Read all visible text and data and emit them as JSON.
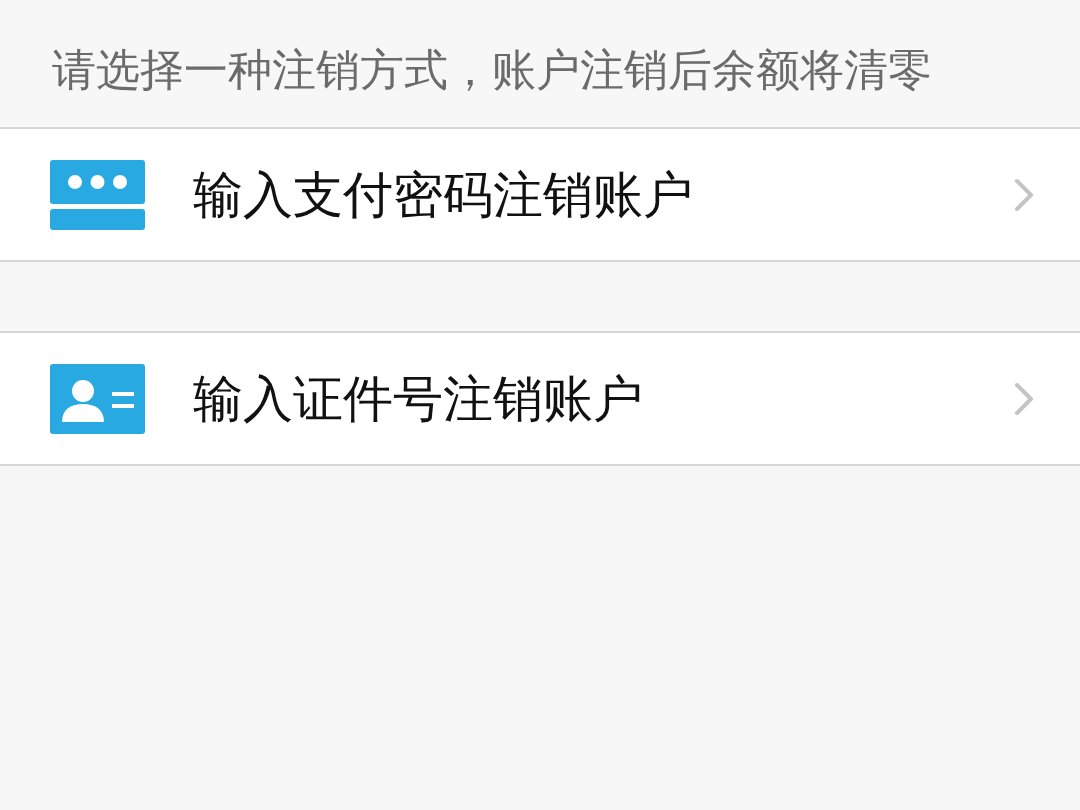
{
  "hint": "请选择一种注销方式，账户注销后余额将清零",
  "options": [
    {
      "kind": "password",
      "label": "输入支付密码注销账户"
    },
    {
      "kind": "id_card",
      "label": "输入证件号注销账户"
    }
  ]
}
